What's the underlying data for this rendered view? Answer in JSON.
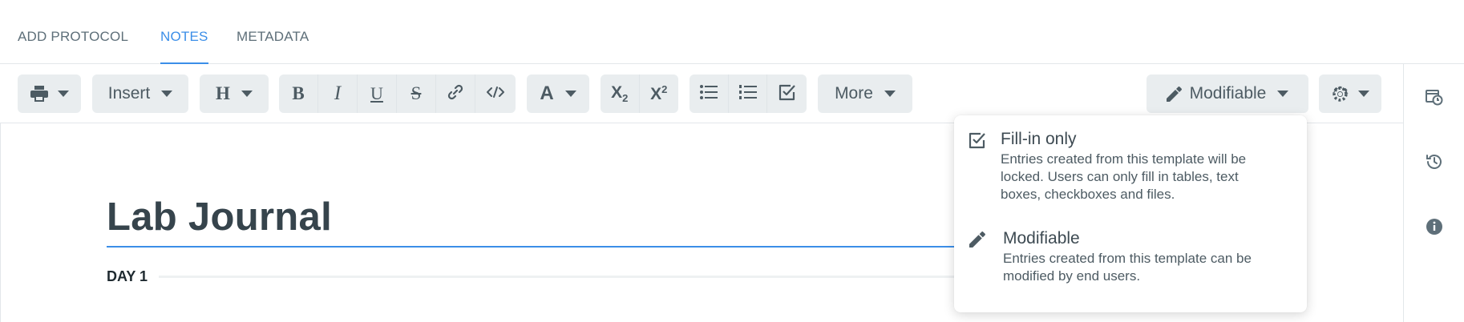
{
  "tabs": [
    {
      "label": "ADD PROTOCOL",
      "active": false
    },
    {
      "label": "NOTES",
      "active": true
    },
    {
      "label": "METADATA",
      "active": false
    }
  ],
  "toolbar": {
    "insert_label": "Insert",
    "heading_label": "H",
    "font_color_label": "A",
    "more_label": "More",
    "mode_label": "Modifiable",
    "icons": [
      "print-icon",
      "bold-icon",
      "italic-icon",
      "underline-icon",
      "strikethrough-icon",
      "link-icon",
      "code-icon",
      "subscript-icon",
      "superscript-icon",
      "bullet-list-icon",
      "numbered-list-icon",
      "checklist-icon",
      "pencil-icon",
      "gear-icon"
    ]
  },
  "document": {
    "title": "Lab Journal",
    "section": "DAY 1"
  },
  "mode_menu": {
    "options": [
      {
        "title": "Fill-in only",
        "description": [
          "Entries created from this template will be",
          "locked. Users can only fill in tables, text",
          "boxes, checkboxes and files."
        ]
      },
      {
        "title": "Modifiable",
        "description": [
          "Entries created from this template can be",
          "modified by end users."
        ]
      }
    ]
  },
  "sidebar": {
    "icons": [
      "calendar-clock-icon",
      "history-icon",
      "info-icon"
    ]
  },
  "colors": {
    "accent": "#3b8ee8",
    "button_bg": "#e9edef",
    "text": "#3d4a52"
  }
}
